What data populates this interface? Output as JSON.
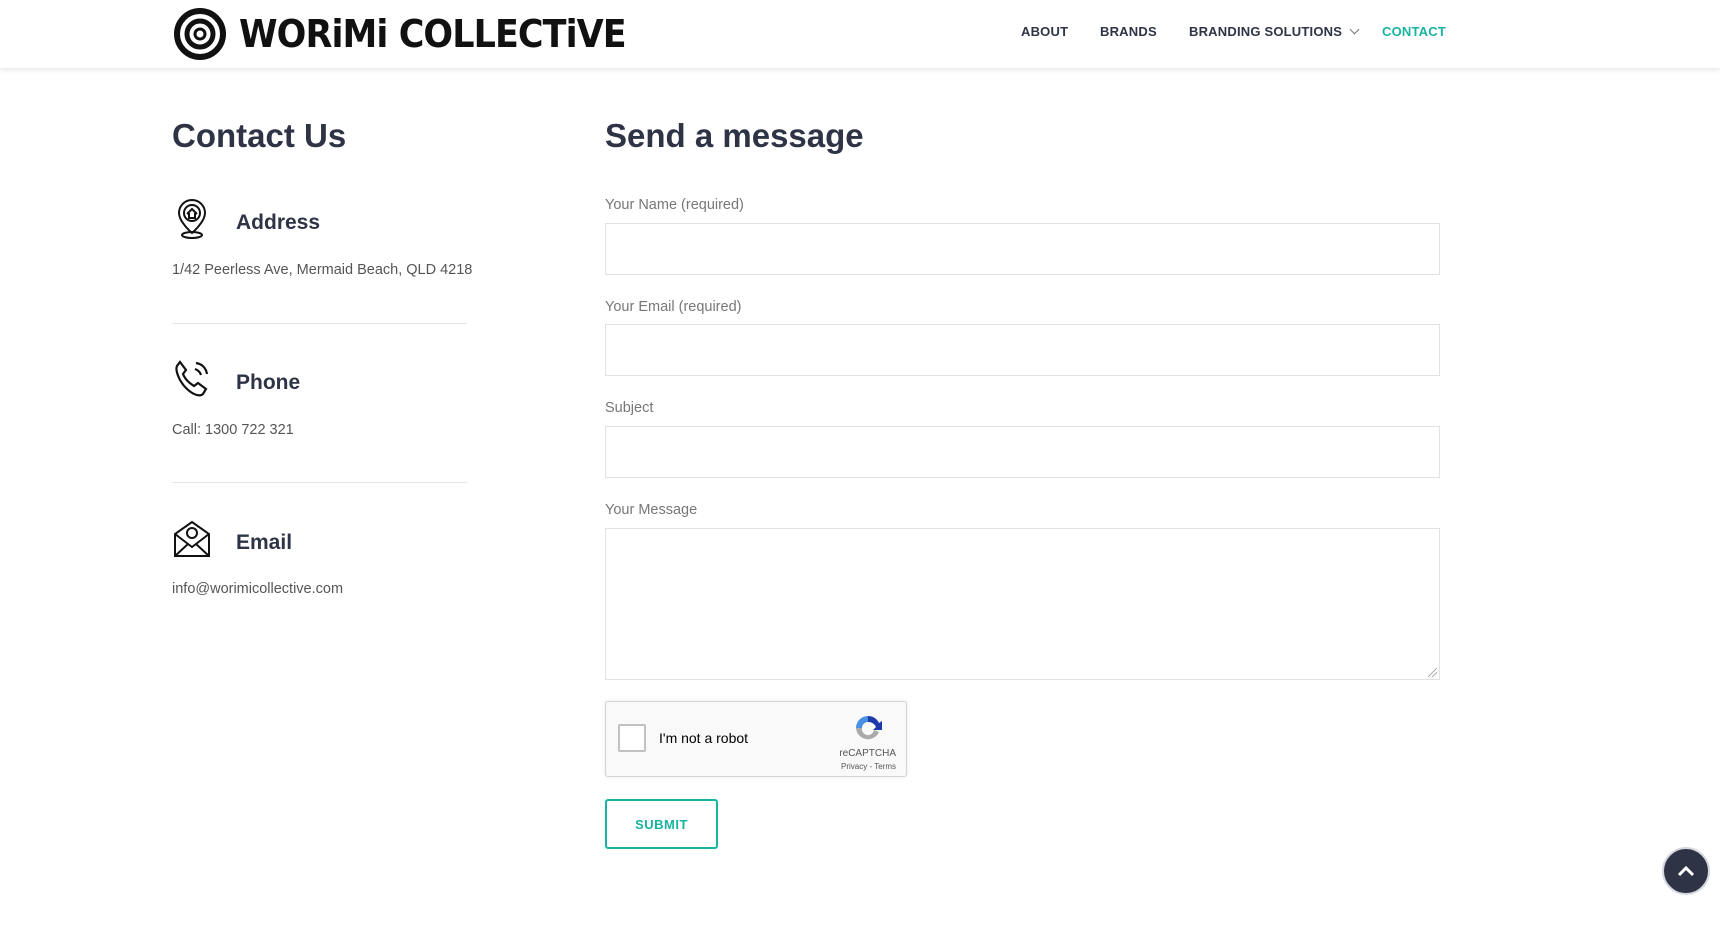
{
  "header": {
    "logo_text": "WORiMi COLLECTiVE",
    "nav": [
      {
        "label": "ABOUT"
      },
      {
        "label": "BRANDS"
      },
      {
        "label": "BRANDING SOLUTIONS"
      },
      {
        "label": "CONTACT",
        "active": true
      }
    ]
  },
  "contact": {
    "title": "Contact Us",
    "address": {
      "label": "Address",
      "text": "1/42 Peerless Ave, Mermaid Beach, QLD 4218"
    },
    "phone": {
      "label": "Phone",
      "text": "Call: 1300 722 321"
    },
    "email": {
      "label": "Email",
      "text": "info@worimicollective.com"
    }
  },
  "form": {
    "title": "Send a message",
    "name_label": "Your Name (required)",
    "email_label": "Your Email (required)",
    "subject_label": "Subject",
    "message_label": "Your Message",
    "captcha": {
      "text": "I'm not a robot",
      "brand": "reCAPTCHA",
      "links": "Privacy - Terms"
    },
    "submit_label": "SUBMIT"
  },
  "colors": {
    "accent": "#18b3a0",
    "heading": "#2e3446"
  }
}
